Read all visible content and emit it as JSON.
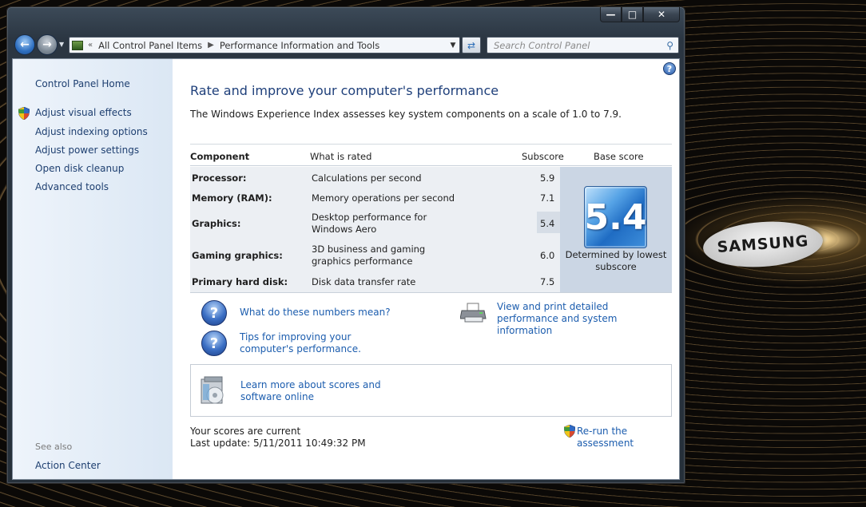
{
  "desktop": {
    "brand_logo_text": "SAMSUNG"
  },
  "window": {
    "caption_buttons": {
      "minimize": "—",
      "maximize": "□",
      "close": "✕"
    }
  },
  "nav": {
    "breadcrumb": [
      "All Control Panel Items",
      "Performance Information and Tools"
    ],
    "search_placeholder": "Search Control Panel"
  },
  "left_pane": {
    "home": "Control Panel Home",
    "tasks": [
      "Adjust visual effects",
      "Adjust indexing options",
      "Adjust power settings",
      "Open disk cleanup",
      "Advanced tools"
    ],
    "see_also_label": "See also",
    "see_also_items": [
      "Action Center"
    ]
  },
  "main": {
    "title": "Rate and improve your computer's performance",
    "intro": "The Windows Experience Index assesses key system components on a scale of 1.0 to 7.9.",
    "table": {
      "headers": {
        "component": "Component",
        "what": "What is rated",
        "subscore": "Subscore",
        "base": "Base score"
      },
      "rows": [
        {
          "component": "Processor:",
          "what": "Calculations per second",
          "subscore": "5.9"
        },
        {
          "component": "Memory (RAM):",
          "what": "Memory operations per second",
          "subscore": "7.1"
        },
        {
          "component": "Graphics:",
          "what": "Desktop performance for Windows Aero",
          "subscore": "5.4"
        },
        {
          "component": "Gaming graphics:",
          "what": "3D business and gaming graphics performance",
          "subscore": "6.0"
        },
        {
          "component": "Primary hard disk:",
          "what": "Disk data transfer rate",
          "subscore": "7.5"
        }
      ],
      "base_score": "5.4",
      "base_caption": "Determined by lowest subscore"
    },
    "links": {
      "what_numbers": "What do these numbers mean?",
      "tips": "Tips for improving your computer's performance.",
      "view_print": "View and print detailed performance and system information",
      "learn_more": "Learn more about scores and software online",
      "rerun": "Re-run the assessment"
    },
    "status": {
      "current": "Your scores are current",
      "last_update": "Last update: 5/11/2011 10:49:32 PM"
    }
  },
  "colors": {
    "link": "#1c5dae",
    "title": "#1e3f7a",
    "left_pane_link": "#1e3f70"
  }
}
